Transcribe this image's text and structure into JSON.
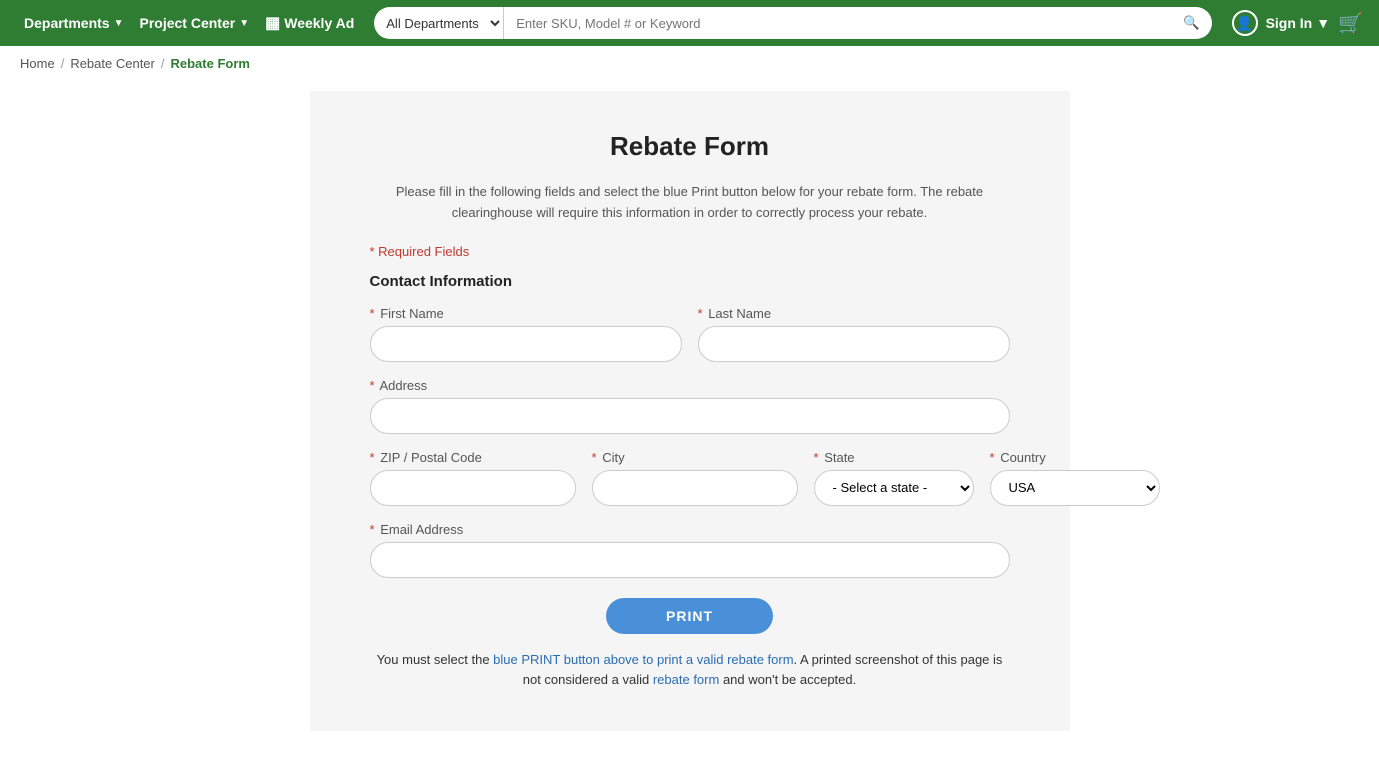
{
  "header": {
    "departments_label": "Departments",
    "project_center_label": "Project Center",
    "weekly_ad_label": "Weekly Ad",
    "search_placeholder": "Enter SKU, Model # or Keyword",
    "search_dept_default": "All Departments",
    "sign_in_label": "Sign In"
  },
  "breadcrumb": {
    "home": "Home",
    "rebate_center": "Rebate Center",
    "current": "Rebate Form"
  },
  "form": {
    "title": "Rebate Form",
    "description": "Please fill in the following fields and select the blue Print button below for your rebate form. The rebate clearinghouse will require this information in order to correctly process your rebate.",
    "required_note": "* Required Fields",
    "section_title": "Contact Information",
    "first_name_label": "First Name",
    "last_name_label": "Last Name",
    "address_label": "Address",
    "zip_label": "ZIP / Postal Code",
    "city_label": "City",
    "state_label": "State",
    "country_label": "Country",
    "email_label": "Email Address",
    "state_placeholder": "- Select a state -",
    "country_default": "USA",
    "print_button": "PRINT",
    "bottom_note": "You must select the blue PRINT button above to print a valid rebate form. A printed screenshot of this page is not considered a valid rebate form and won't be accepted."
  }
}
